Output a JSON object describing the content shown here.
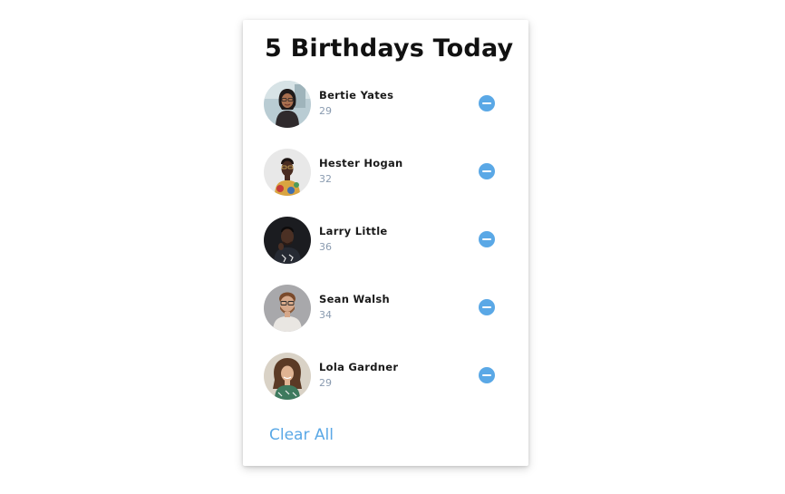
{
  "header": {
    "title": "5 Birthdays Today"
  },
  "people": [
    {
      "name": "Bertie Yates",
      "age": "29",
      "avatar": "woman-with-glasses-photo"
    },
    {
      "name": "Hester Hogan",
      "age": "32",
      "avatar": "woman-floral-top-photo"
    },
    {
      "name": "Larry Little",
      "age": "36",
      "avatar": "man-dark-background-photo"
    },
    {
      "name": "Sean Walsh",
      "age": "34",
      "avatar": "man-with-glasses-photo"
    },
    {
      "name": "Lola Gardner",
      "age": "29",
      "avatar": "woman-curly-hair-photo"
    }
  ],
  "actions": {
    "remove_icon": "minus-circle-icon",
    "clear_label": "Clear All"
  },
  "colors": {
    "accent": "#5aa8e6",
    "age_text": "#8a9bb0",
    "title_text": "#111111"
  }
}
